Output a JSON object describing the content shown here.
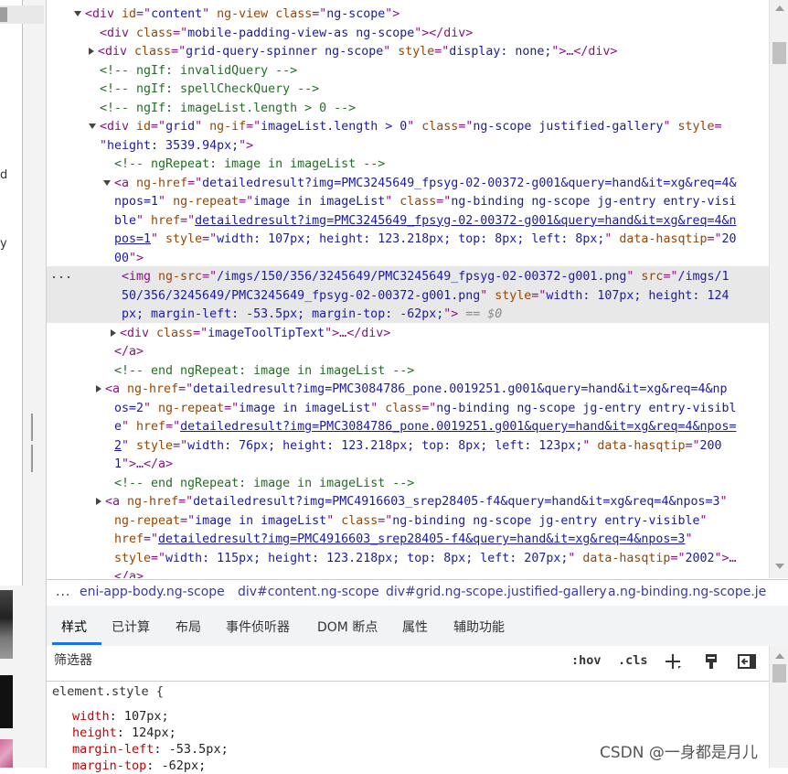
{
  "page_strip": {
    "letters": [
      "d",
      "y"
    ]
  },
  "tree": {
    "lines": [
      {
        "indent": 3,
        "tri": "down",
        "html": [
          [
            "tag",
            "<div "
          ],
          [
            "an",
            "id"
          ],
          [
            "tag",
            "=\""
          ],
          [
            "av",
            "content"
          ],
          [
            "tag",
            "\" "
          ],
          [
            "an",
            "ng-view"
          ],
          [
            "tag",
            " "
          ],
          [
            "an",
            "class"
          ],
          [
            "tag",
            "=\""
          ],
          [
            "av",
            "ng-scope"
          ],
          [
            "tag",
            "\">"
          ]
        ]
      },
      {
        "indent": 5,
        "html": [
          [
            "tag",
            "<div "
          ],
          [
            "an",
            "class"
          ],
          [
            "tag",
            "=\""
          ],
          [
            "av",
            "mobile-padding-view-as ng-scope"
          ],
          [
            "tag",
            "\"></div>"
          ]
        ]
      },
      {
        "indent": 5,
        "tri": "right",
        "html": [
          [
            "tag",
            "<div "
          ],
          [
            "an",
            "class"
          ],
          [
            "tag",
            "=\""
          ],
          [
            "av",
            "grid-query-spinner ng-scope"
          ],
          [
            "tag",
            "\" "
          ],
          [
            "an",
            "style"
          ],
          [
            "tag",
            "=\""
          ],
          [
            "av",
            "display: none;"
          ],
          [
            "tag",
            "\">…</div>"
          ]
        ]
      },
      {
        "indent": 5,
        "html": [
          [
            "cm",
            "<!-- ngIf: invalidQuery -->"
          ]
        ]
      },
      {
        "indent": 5,
        "html": [
          [
            "cm",
            "<!-- ngIf: spellCheckQuery -->"
          ]
        ]
      },
      {
        "indent": 5,
        "html": [
          [
            "cm",
            "<!-- ngIf: imageList.length > 0 -->"
          ]
        ]
      },
      {
        "indent": 5,
        "tri": "down",
        "html": [
          [
            "tag",
            "<div "
          ],
          [
            "an",
            "id"
          ],
          [
            "tag",
            "=\""
          ],
          [
            "av",
            "grid"
          ],
          [
            "tag",
            "\" "
          ],
          [
            "an",
            "ng-if"
          ],
          [
            "tag",
            "=\""
          ],
          [
            "av",
            "imageList.length > 0"
          ],
          [
            "tag",
            "\" "
          ],
          [
            "an",
            "class"
          ],
          [
            "tag",
            "=\""
          ],
          [
            "av",
            "ng-scope justified-gallery"
          ],
          [
            "tag",
            "\" "
          ],
          [
            "an",
            "style"
          ],
          [
            "tag",
            "="
          ]
        ]
      },
      {
        "indent": 5,
        "html": [
          [
            "tag",
            "\""
          ],
          [
            "av",
            "height: 3539.94px;"
          ],
          [
            "tag",
            "\">"
          ]
        ]
      },
      {
        "indent": 7,
        "html": [
          [
            "cm",
            "<!-- ngRepeat: image in imageList -->"
          ]
        ]
      },
      {
        "indent": 7,
        "tri": "down",
        "html": [
          [
            "tag",
            "<a "
          ],
          [
            "an",
            "ng-href"
          ],
          [
            "tag",
            "=\""
          ],
          [
            "av",
            "detailedresult?img=PMC3245649_fpsyg-02-00372-g001&query=hand&it=xg&req=4&"
          ]
        ]
      },
      {
        "indent": 7,
        "html": [
          [
            "av",
            "npos=1"
          ],
          [
            "tag",
            "\" "
          ],
          [
            "an",
            "ng-repeat"
          ],
          [
            "tag",
            "=\""
          ],
          [
            "av",
            "image in imageList"
          ],
          [
            "tag",
            "\" "
          ],
          [
            "an",
            "class"
          ],
          [
            "tag",
            "=\""
          ],
          [
            "av",
            "ng-binding ng-scope jg-entry entry-visi"
          ]
        ]
      },
      {
        "indent": 7,
        "html": [
          [
            "av",
            "ble"
          ],
          [
            "tag",
            "\" "
          ],
          [
            "an",
            "href"
          ],
          [
            "tag",
            "=\""
          ],
          [
            "link",
            "detailedresult?img=PMC3245649_fpsyg-02-00372-g001&query=hand&it=xg&req=4&n"
          ]
        ]
      },
      {
        "indent": 7,
        "html": [
          [
            "link",
            "pos=1"
          ],
          [
            "tag",
            "\" "
          ],
          [
            "an",
            "style"
          ],
          [
            "tag",
            "=\""
          ],
          [
            "av",
            "width: 107px; height: 123.218px; top: 8px; left: 8px;"
          ],
          [
            "tag",
            "\" "
          ],
          [
            "an",
            "data-hasqtip"
          ],
          [
            "tag",
            "=\""
          ],
          [
            "av",
            "20"
          ]
        ]
      },
      {
        "indent": 7,
        "html": [
          [
            "av",
            "00"
          ],
          [
            "tag",
            "\">"
          ]
        ]
      },
      {
        "indent": 8,
        "sel": true,
        "html": [
          [
            "tag",
            "<img "
          ],
          [
            "an",
            "ng-src"
          ],
          [
            "tag",
            "=\""
          ],
          [
            "av",
            "/imgs/150/356/3245649/PMC3245649_fpsyg-02-00372-g001.png"
          ],
          [
            "tag",
            "\" "
          ],
          [
            "an",
            "src"
          ],
          [
            "tag",
            "=\""
          ],
          [
            "av",
            "/imgs/1"
          ]
        ]
      },
      {
        "indent": 8,
        "sel": true,
        "html": [
          [
            "av",
            "50/356/3245649/PMC3245649_fpsyg-02-00372-g001.png"
          ],
          [
            "tag",
            "\" "
          ],
          [
            "an",
            "style"
          ],
          [
            "tag",
            "=\""
          ],
          [
            "av",
            "width: 107px; height: 124"
          ]
        ]
      },
      {
        "indent": 8,
        "sel": true,
        "html": [
          [
            "av",
            "px; margin-left: -53.5px; margin-top: -62px;"
          ],
          [
            "tag",
            "\">"
          ],
          [
            "eq",
            " == $0"
          ]
        ]
      },
      {
        "indent": 8,
        "tri": "right",
        "html": [
          [
            "tag",
            "<div "
          ],
          [
            "an",
            "class"
          ],
          [
            "tag",
            "=\""
          ],
          [
            "av",
            "imageToolTipText"
          ],
          [
            "tag",
            "\">…</div>"
          ]
        ]
      },
      {
        "indent": 7,
        "html": [
          [
            "tag",
            "</a>"
          ]
        ]
      },
      {
        "indent": 7,
        "html": [
          [
            "cm",
            "<!-- end ngRepeat: image in imageList -->"
          ]
        ]
      },
      {
        "indent": 6,
        "tri": "right",
        "html": [
          [
            "tag",
            "<a "
          ],
          [
            "an",
            "ng-href"
          ],
          [
            "tag",
            "=\""
          ],
          [
            "av",
            "detailedresult?img=PMC3084786_pone.0019251.g001&query=hand&it=xg&req=4&np"
          ]
        ]
      },
      {
        "indent": 7,
        "html": [
          [
            "av",
            "os=2"
          ],
          [
            "tag",
            "\" "
          ],
          [
            "an",
            "ng-repeat"
          ],
          [
            "tag",
            "=\""
          ],
          [
            "av",
            "image in imageList"
          ],
          [
            "tag",
            "\" "
          ],
          [
            "an",
            "class"
          ],
          [
            "tag",
            "=\""
          ],
          [
            "av",
            "ng-binding ng-scope jg-entry entry-visibl"
          ]
        ]
      },
      {
        "indent": 7,
        "html": [
          [
            "av",
            "e"
          ],
          [
            "tag",
            "\" "
          ],
          [
            "an",
            "href"
          ],
          [
            "tag",
            "=\""
          ],
          [
            "link",
            "detailedresult?img=PMC3084786_pone.0019251.g001&query=hand&it=xg&req=4&npos="
          ]
        ]
      },
      {
        "indent": 7,
        "html": [
          [
            "link",
            "2"
          ],
          [
            "tag",
            "\" "
          ],
          [
            "an",
            "style"
          ],
          [
            "tag",
            "=\""
          ],
          [
            "av",
            "width: 76px; height: 123.218px; top: 8px; left: 123px;"
          ],
          [
            "tag",
            "\" "
          ],
          [
            "an",
            "data-hasqtip"
          ],
          [
            "tag",
            "=\""
          ],
          [
            "av",
            "200"
          ]
        ]
      },
      {
        "indent": 7,
        "html": [
          [
            "av",
            "1"
          ],
          [
            "tag",
            "\">…</a>"
          ]
        ]
      },
      {
        "indent": 7,
        "html": [
          [
            "cm",
            "<!-- end ngRepeat: image in imageList -->"
          ]
        ]
      },
      {
        "indent": 6,
        "tri": "right",
        "html": [
          [
            "tag",
            "<a "
          ],
          [
            "an",
            "ng-href"
          ],
          [
            "tag",
            "=\""
          ],
          [
            "av",
            "detailedresult?img=PMC4916603_srep28405-f4&query=hand&it=xg&req=4&npos=3"
          ],
          [
            "tag",
            "\""
          ]
        ]
      },
      {
        "indent": 7,
        "html": [
          [
            "an",
            "ng-repeat"
          ],
          [
            "tag",
            "=\""
          ],
          [
            "av",
            "image in imageList"
          ],
          [
            "tag",
            "\" "
          ],
          [
            "an",
            "class"
          ],
          [
            "tag",
            "=\""
          ],
          [
            "av",
            "ng-binding ng-scope jg-entry entry-visible"
          ],
          [
            "tag",
            "\""
          ]
        ]
      },
      {
        "indent": 7,
        "html": [
          [
            "an",
            "href"
          ],
          [
            "tag",
            "=\""
          ],
          [
            "link",
            "detailedresult?img=PMC4916603_srep28405-f4&query=hand&it=xg&req=4&npos=3"
          ],
          [
            "tag",
            "\""
          ]
        ]
      },
      {
        "indent": 7,
        "html": [
          [
            "an",
            "style"
          ],
          [
            "tag",
            "=\""
          ],
          [
            "av",
            "width: 115px; height: 123.218px; top: 8px; left: 207px;"
          ],
          [
            "tag",
            "\" "
          ],
          [
            "an",
            "data-hasqtip"
          ],
          [
            "tag",
            "=\""
          ],
          [
            "av",
            "2002"
          ],
          [
            "tag",
            "\">…"
          ]
        ]
      },
      {
        "indent": 7,
        "html": [
          [
            "tag",
            "</a>"
          ]
        ]
      }
    ],
    "row_dots": "..."
  },
  "breadcrumb": {
    "more": "...",
    "items": [
      "eni-app-body.ng-scope",
      "div#content.ng-scope",
      "div#grid.ng-scope.justified-gallery",
      "a.ng-binding.ng-scope.je"
    ]
  },
  "tabs": [
    "样式",
    "已计算",
    "布局",
    "事件侦听器",
    "DOM 断点",
    "属性",
    "辅助功能"
  ],
  "filter": {
    "placeholder": "筛选器",
    "hov": ":hov",
    "cls": ".cls"
  },
  "styles": {
    "selector": "element.style {",
    "props": [
      {
        "name": "width",
        "value": "107px;"
      },
      {
        "name": "height",
        "value": "124px;"
      },
      {
        "name": "margin-left",
        "value": "-53.5px;"
      },
      {
        "name": "margin-top",
        "value": "-62px;"
      }
    ]
  },
  "watermark": "CSDN @一身都是月儿",
  "colors": {
    "accent": "#1a73e8",
    "tag": "#881280",
    "attr_name": "#994500",
    "attr_value": "#1a1aa6",
    "comment": "#236e25"
  }
}
